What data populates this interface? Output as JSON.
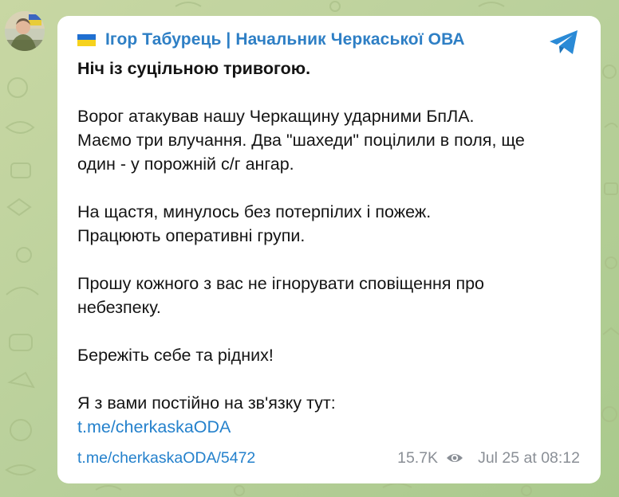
{
  "channel": {
    "flag_icon": "ukraine-flag-icon",
    "name": "Ігор Табурець | Начальник Черкаської ОВА",
    "avatar": "channel-avatar"
  },
  "message": {
    "headline": "Ніч із суцільною тривогою.",
    "paragraphs": [
      [
        "Ворог атакував нашу Черкащину ударними БпЛА.",
        "Маємо три влучання. Два \"шахеди\" поцілили в поля, ще",
        "один - у порожній с/г ангар."
      ],
      [
        "На щастя, минулось без потерпілих і пожеж.",
        "Працюють оперативні групи."
      ],
      [
        "Прошу кожного з вас не ігнорувати сповіщення про",
        "небезпеку."
      ],
      [
        "Бережіть себе та рідних!"
      ]
    ],
    "contact_line": "Я з вами постійно на зв'язку тут:",
    "contact_link": "t.me/cherkaskaODA"
  },
  "footer": {
    "post_link": "t.me/cherkaskaODA/5472",
    "views": "15.7K",
    "views_icon": "eye-icon",
    "timestamp": "Jul 25 at 08:12"
  },
  "share_icon": "telegram-share-icon",
  "colors": {
    "accent": "#2e7fc5",
    "link": "#2481cc",
    "meta": "#8a8f96",
    "wallpaper": "#c9d8a6"
  }
}
